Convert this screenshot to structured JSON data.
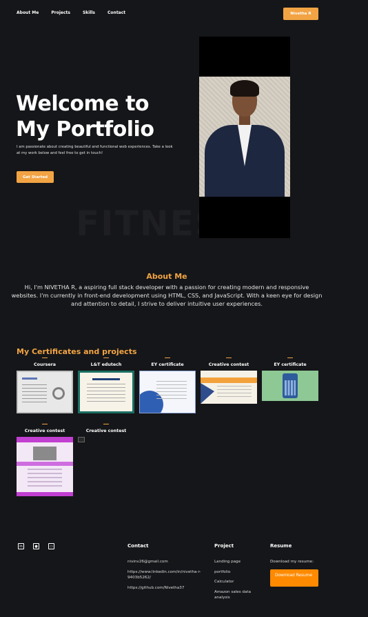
{
  "nav": {
    "links": [
      "About Me",
      "Projects",
      "Skills",
      "Contact"
    ],
    "cta": "Nivetha R"
  },
  "hero": {
    "title_line1": "Welcome to",
    "title_line2": "My Portfolio",
    "text": "I am passionate about creating beautiful and functional web experiences. Take a look at my work below and feel free to get in touch!",
    "button": "Get Started",
    "bg_word": "FITNESS"
  },
  "about": {
    "heading": "About Me",
    "text": "Hi, I'm NIVETHA R, a aspiring full stack developer with a passion for creating modern and responsive websites. I'm currently in front-end development using HTML, CSS, and JavaScript. With a keen eye for design and attention to detail, I strive to deliver intuitive user experiences."
  },
  "certificates": {
    "heading": "My Certificates and projects",
    "items": [
      {
        "title": "Coursera"
      },
      {
        "title": "L&T edutech"
      },
      {
        "title": "EY certificate"
      },
      {
        "title": "Creative contest"
      },
      {
        "title": "EY certificate"
      },
      {
        "title": "Creative contest"
      },
      {
        "title": "Creative contest"
      }
    ]
  },
  "footer": {
    "social_icons": [
      "linkedin-icon",
      "github-icon",
      "laptop-icon"
    ],
    "contact": {
      "heading": "Contact",
      "items": [
        "nivinv26@gmail.com",
        "https://www.linkedin.com/in/nivetha-r-9403b5262/",
        "https://github.com/Nivetha37"
      ]
    },
    "project": {
      "heading": "Project",
      "items": [
        "Landing page",
        "portfolio",
        "Calculator",
        "Amazon sales data analysis"
      ]
    },
    "resume": {
      "heading": "Resume",
      "text": "Download my resume:",
      "button": "Download Resume"
    }
  },
  "colors": {
    "background": "#151619",
    "accent": "#f2a444",
    "resume_button": "#ff8a00"
  }
}
